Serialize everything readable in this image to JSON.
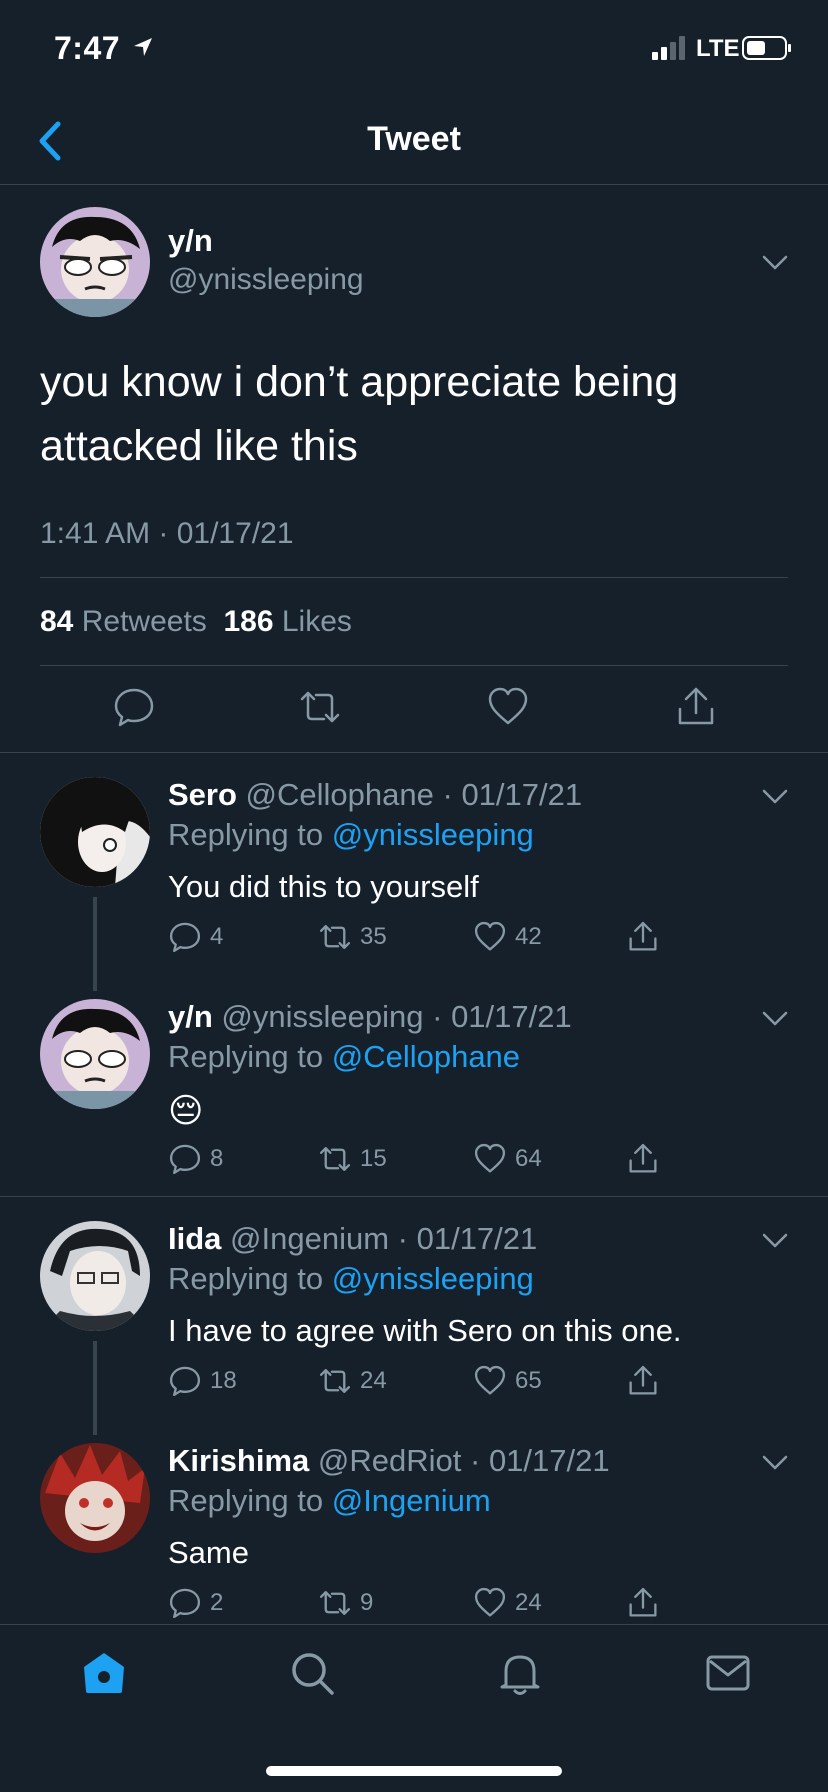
{
  "status_bar": {
    "time": "7:47",
    "network": "LTE"
  },
  "nav": {
    "title": "Tweet"
  },
  "main_tweet": {
    "name": "y/n",
    "handle": "@ynissleeping",
    "text": "you know i don’t appreciate being attacked like this",
    "timestamp": "1:41 AM · 01/17/21",
    "retweets_count": "84",
    "retweets_label": "Retweets",
    "likes_count": "186",
    "likes_label": "Likes"
  },
  "replies": [
    {
      "name": "Sero",
      "handle": "@Cellophane",
      "date": "01/17/21",
      "replying_prefix": "Replying to ",
      "replying_to": "@ynissleeping",
      "text": "You did this to yourself",
      "comments": "4",
      "retweets": "35",
      "likes": "42"
    },
    {
      "name": "y/n",
      "handle": "@ynissleeping",
      "date": "01/17/21",
      "replying_prefix": "Replying to ",
      "replying_to": "@Cellophane",
      "text": "😔",
      "comments": "8",
      "retweets": "15",
      "likes": "64"
    },
    {
      "name": "Iida",
      "handle": "@Ingenium",
      "date": "01/17/21",
      "replying_prefix": "Replying to ",
      "replying_to": "@ynissleeping",
      "text": "I have to agree with Sero on this one.",
      "comments": "18",
      "retweets": "24",
      "likes": "65"
    },
    {
      "name": "Kirishima",
      "handle": "@RedRiot",
      "date": "01/17/21",
      "replying_prefix": "Replying to ",
      "replying_to": "@Ingenium",
      "text": "Same",
      "comments": "2",
      "retweets": "9",
      "likes": "24"
    }
  ],
  "tabbar": {
    "items": [
      "home-icon",
      "search-icon",
      "notifications-icon",
      "messages-icon"
    ],
    "active": "home-icon"
  },
  "colors": {
    "background": "#15202b",
    "accent": "#1da1f2",
    "muted": "#8899a6",
    "divider": "#38444d"
  }
}
